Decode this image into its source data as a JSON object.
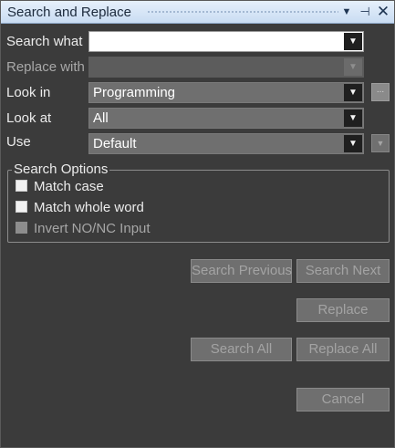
{
  "titlebar": {
    "title": "Search and Replace",
    "dropdown_icon": "chevron-down-icon",
    "pin_icon": "pin-icon",
    "close_icon": "close-icon"
  },
  "fields": {
    "search_what": {
      "label": "Search what",
      "value": ""
    },
    "replace_with": {
      "label": "Replace with",
      "value": ""
    },
    "look_in": {
      "label": "Look in",
      "value": "Programming"
    },
    "look_at": {
      "label": "Look at",
      "value": "All"
    },
    "use": {
      "label": "Use",
      "value": "Default"
    }
  },
  "browse_label": "...",
  "search_options": {
    "legend": "Search Options",
    "match_case": "Match case",
    "match_whole_word": "Match whole word",
    "invert_input": "Invert NO/NC Input"
  },
  "buttons": {
    "search_previous": "Search Previous",
    "search_next": "Search Next",
    "replace": "Replace",
    "search_all": "Search All",
    "replace_all": "Replace All",
    "cancel": "Cancel"
  },
  "colors": {
    "titlebar": "#d6e4f5",
    "panel_bg": "#3b3b3b",
    "field_bg": "#6f6f6f",
    "disabled_text": "#a3a3a3"
  }
}
